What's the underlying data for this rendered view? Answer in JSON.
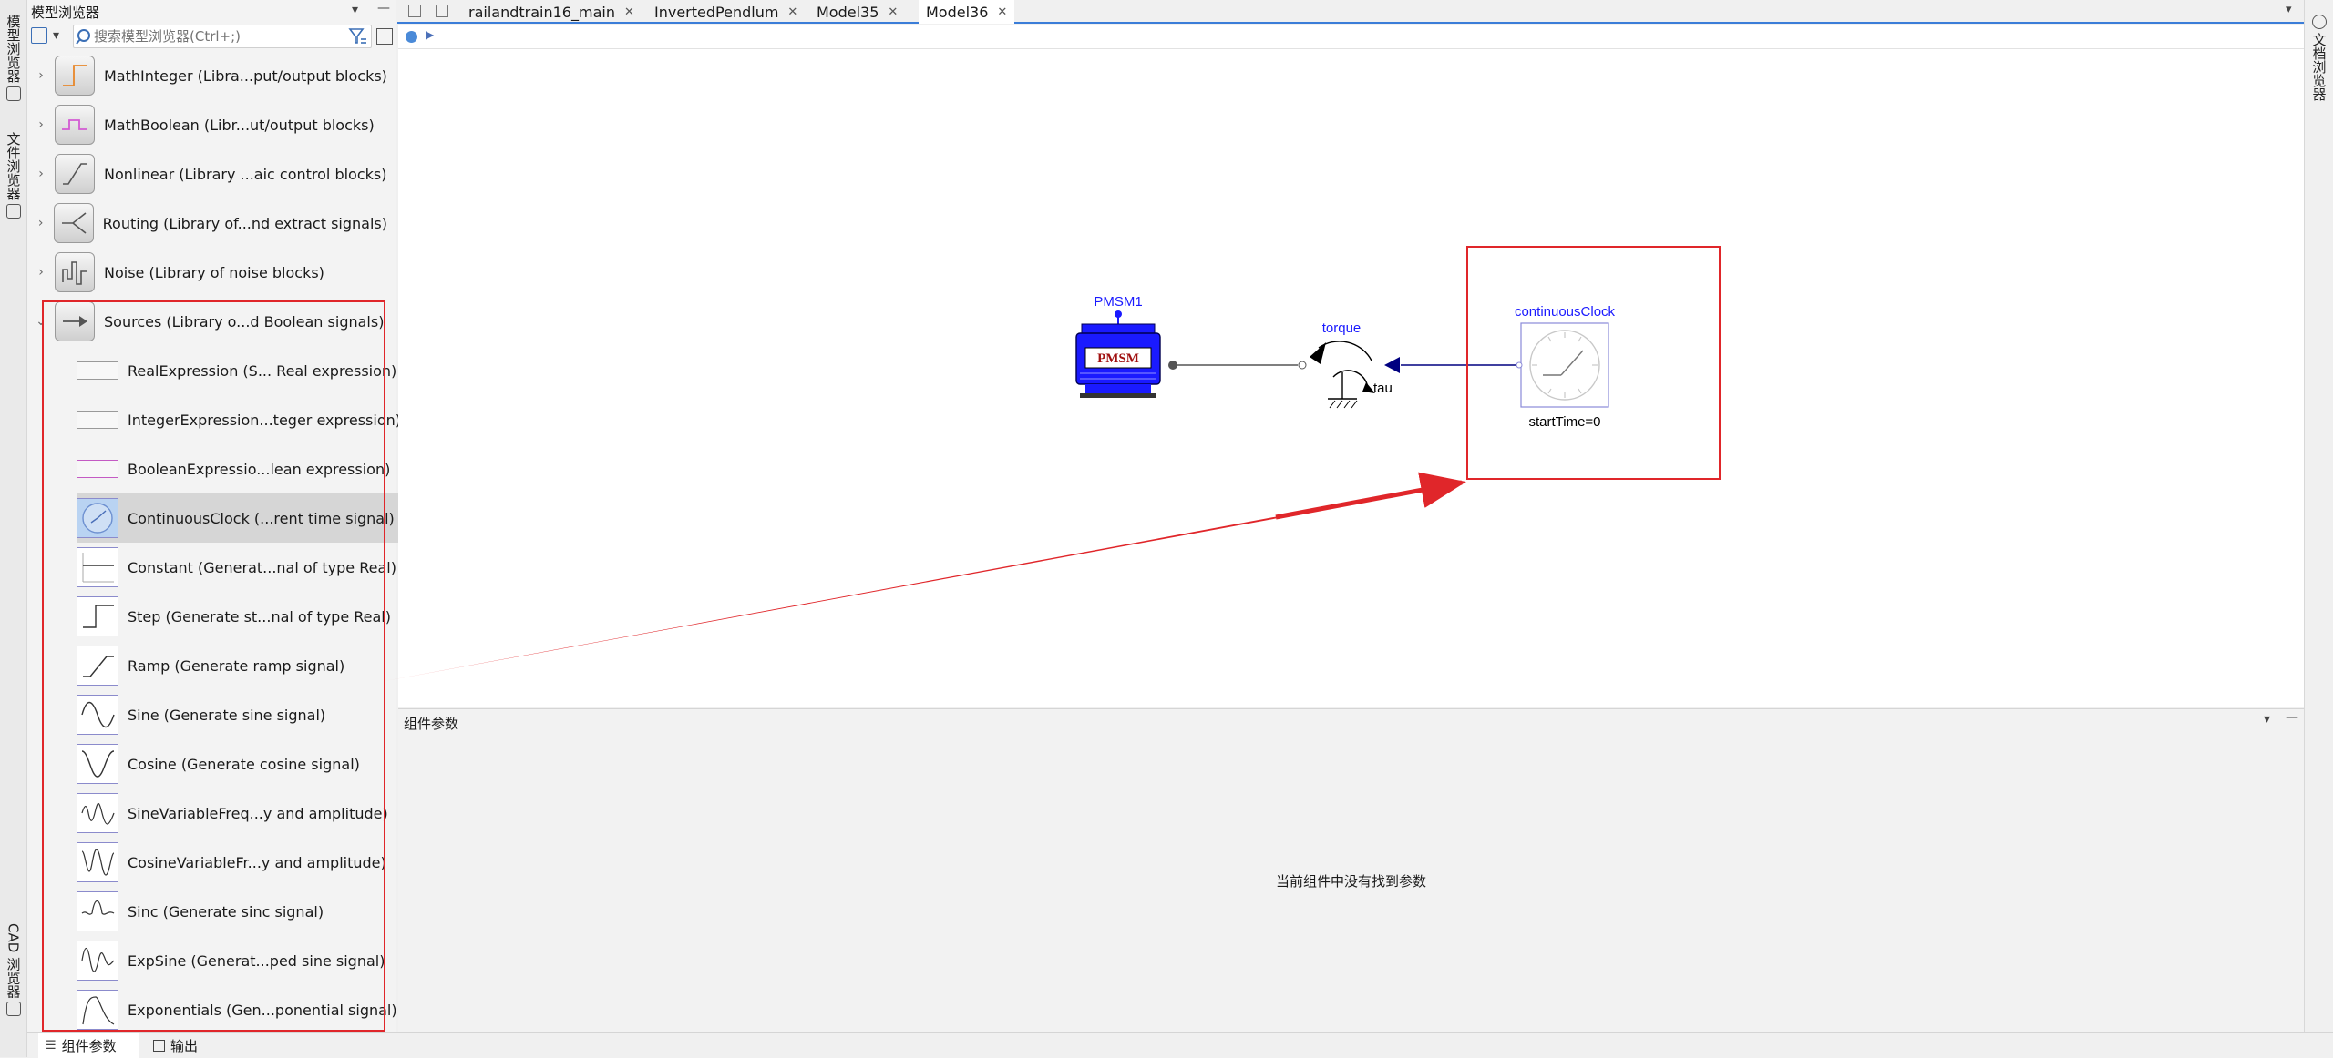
{
  "left_strip": {
    "tab_model_browser": "模型浏览器",
    "tab_file_browser": "文件浏览器",
    "tab_cad_browser": "CAD 浏览器"
  },
  "right_strip": {
    "tab_doc_browser": "文档浏览器"
  },
  "model_browser": {
    "title": "模型浏览器",
    "search_placeholder": "搜索模型浏览器(Ctrl+;)",
    "libraries": [
      {
        "label": "MathInteger (Libra...put/output blocks)",
        "icon": "math-integer-icon"
      },
      {
        "label": "MathBoolean (Libr...ut/output blocks)",
        "icon": "math-boolean-icon"
      },
      {
        "label": "Nonlinear (Library ...aic control blocks)",
        "icon": "nonlinear-icon"
      },
      {
        "label": "Routing (Library of...nd extract signals)",
        "icon": "routing-icon"
      },
      {
        "label": "Noise (Library of noise blocks)",
        "icon": "noise-icon"
      },
      {
        "label": "Sources (Library o...d Boolean signals)",
        "icon": "sources-icon"
      }
    ],
    "sources_items": [
      {
        "label": "RealExpression (S... Real expression)",
        "icon": "expression-icon"
      },
      {
        "label": "IntegerExpression...teger expression)",
        "icon": "expression-icon"
      },
      {
        "label": "BooleanExpressio...lean expression)",
        "icon": "expression-icon"
      },
      {
        "label": "ContinuousClock (...rent time signal)",
        "icon": "clock-icon"
      },
      {
        "label": "Constant (Generat...nal of type Real)",
        "icon": "constant-icon"
      },
      {
        "label": "Step (Generate st...nal of type Real)",
        "icon": "step-icon"
      },
      {
        "label": "Ramp (Generate ramp signal)",
        "icon": "ramp-icon"
      },
      {
        "label": "Sine (Generate sine signal)",
        "icon": "sine-icon"
      },
      {
        "label": "Cosine (Generate cosine signal)",
        "icon": "cosine-icon"
      },
      {
        "label": "SineVariableFreq...y and amplitude)",
        "icon": "sine-variable-icon"
      },
      {
        "label": "CosineVariableFr...y and amplitude)",
        "icon": "cosine-variable-icon"
      },
      {
        "label": "Sinc (Generate sinc signal)",
        "icon": "sinc-icon"
      },
      {
        "label": "ExpSine (Generat...ped sine signal)",
        "icon": "expsine-icon"
      },
      {
        "label": "Exponentials (Gen...ponential signal)",
        "icon": "exponentials-icon"
      }
    ],
    "selected_item": "ContinuousClock (...rent time signal)"
  },
  "tabs": [
    {
      "label": "railandtrain16_main",
      "active": false
    },
    {
      "label": "InvertedPendlum",
      "active": false
    },
    {
      "label": "Model35",
      "active": false
    },
    {
      "label": "Model36",
      "active": true
    }
  ],
  "diagram": {
    "pmsm": {
      "name": "PMSM1",
      "text": "PMSM"
    },
    "torque": {
      "name": "torque",
      "port_label": "tau"
    },
    "clock": {
      "name": "continuousClock",
      "param": "startTime=0"
    }
  },
  "params_panel": {
    "title": "组件参数",
    "empty_message": "当前组件中没有找到参数"
  },
  "bottom_tabs": [
    {
      "label": "组件参数",
      "active": true
    },
    {
      "label": "输出",
      "active": false
    }
  ],
  "colors": {
    "highlight_red": "#e0262a",
    "diagram_blue": "#0000ee",
    "tab_accent": "#3b7dd8"
  }
}
